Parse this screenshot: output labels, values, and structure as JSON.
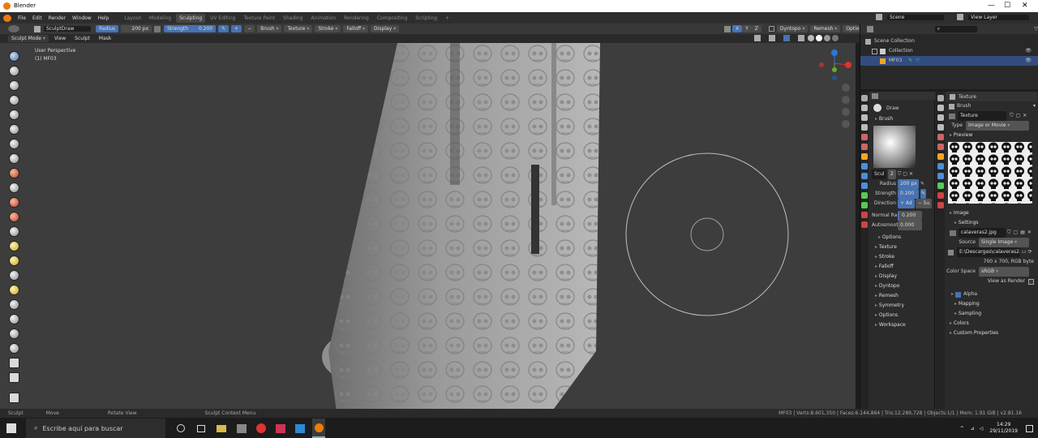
{
  "window": {
    "title": "Blender",
    "minimize": "—",
    "maximize": "☐",
    "close": "✕"
  },
  "menu": {
    "items": [
      "File",
      "Edit",
      "Render",
      "Window",
      "Help"
    ]
  },
  "workspaces": [
    "Layout",
    "Modeling",
    "Sculpting",
    "UV Editing",
    "Texture Paint",
    "Shading",
    "Animation",
    "Rendering",
    "Compositing",
    "Scripting"
  ],
  "active_workspace": "Sculpting",
  "scene": {
    "label": "Scene",
    "view_layer": "View Layer"
  },
  "tool_header": {
    "brush_name": "SculptDraw",
    "radius_label": "Radius",
    "radius_value": "200 px",
    "strength_label": "Strength",
    "strength_value": "0.200",
    "plus": "+",
    "minus": "−",
    "menus": [
      "Brush",
      "Texture",
      "Stroke",
      "Falloff",
      "Display"
    ],
    "xyz": [
      "X",
      "Y",
      "Z"
    ],
    "dyntopo": "Dyntopo",
    "remesh": "Remesh",
    "options": "Options"
  },
  "mode_header": {
    "mode": "Sculpt Mode",
    "items": [
      "View",
      "Sculpt",
      "Mask"
    ]
  },
  "viewport": {
    "perspective": "User Perspective",
    "object": "(1) MF03"
  },
  "gizmo": {
    "z": "Z",
    "y": "Y",
    "x": "X"
  },
  "outliner": {
    "root": "Scene Collection",
    "collection": "Collection",
    "object": "MF03"
  },
  "brush_panel": {
    "brush": "Draw",
    "section": "Brush",
    "name": "Scul",
    "users": "2",
    "radius_label": "Radius",
    "radius": "200 px",
    "strength_label": "Strength",
    "strength": "0.200",
    "direction_label": "Direction",
    "dir_add": "+ Ad",
    "dir_sub": "− Su",
    "normal_label": "Normal Ra...",
    "normal": "0.200",
    "autosmooth_label": "Autosmooth",
    "autosmooth": "0.000",
    "sections": [
      "Options",
      "Texture",
      "Stroke",
      "Falloff",
      "Display",
      "Dyntopo",
      "Remesh",
      "Symmetry",
      "Options",
      "Workspace"
    ]
  },
  "texture_panel": {
    "header": "Texture",
    "brush": "Brush",
    "texture_name": "Texture",
    "type_label": "Type",
    "type": "Image or Movie",
    "preview": "Preview",
    "image": "Image",
    "settings": "Settings",
    "image_name": "calaveras2.jpg",
    "source_label": "Source",
    "source": "Single Image",
    "filepath": "E:\\Descargas\\calaveras2.j...",
    "resolution": "700 x 700,  RGB byte",
    "color_space_label": "Color Space",
    "color_space": "sRGB",
    "view_as_render": "View as Render",
    "alpha": "Alpha",
    "mapping": "Mapping",
    "sampling": "Sampling",
    "colors": "Colors",
    "custom_props": "Custom Properties"
  },
  "status": {
    "sculpt": "Sculpt",
    "move": "Move",
    "rotate": "Rotate View",
    "context": "Sculpt Context Menu",
    "stats": "MF03 | Verts:8.601,350 | Faces:6.144,864 | Tris:12.289,728 | Objects:1/1 | Mem: 1.91 GiB | v2.81.16"
  },
  "taskbar": {
    "search": "Escribe aquí para buscar",
    "time": "14:29",
    "date": "29/11/2019"
  },
  "colors": {
    "accent": "#4772b3",
    "active_tab": "#474747",
    "bg": "#3d3d3d"
  }
}
